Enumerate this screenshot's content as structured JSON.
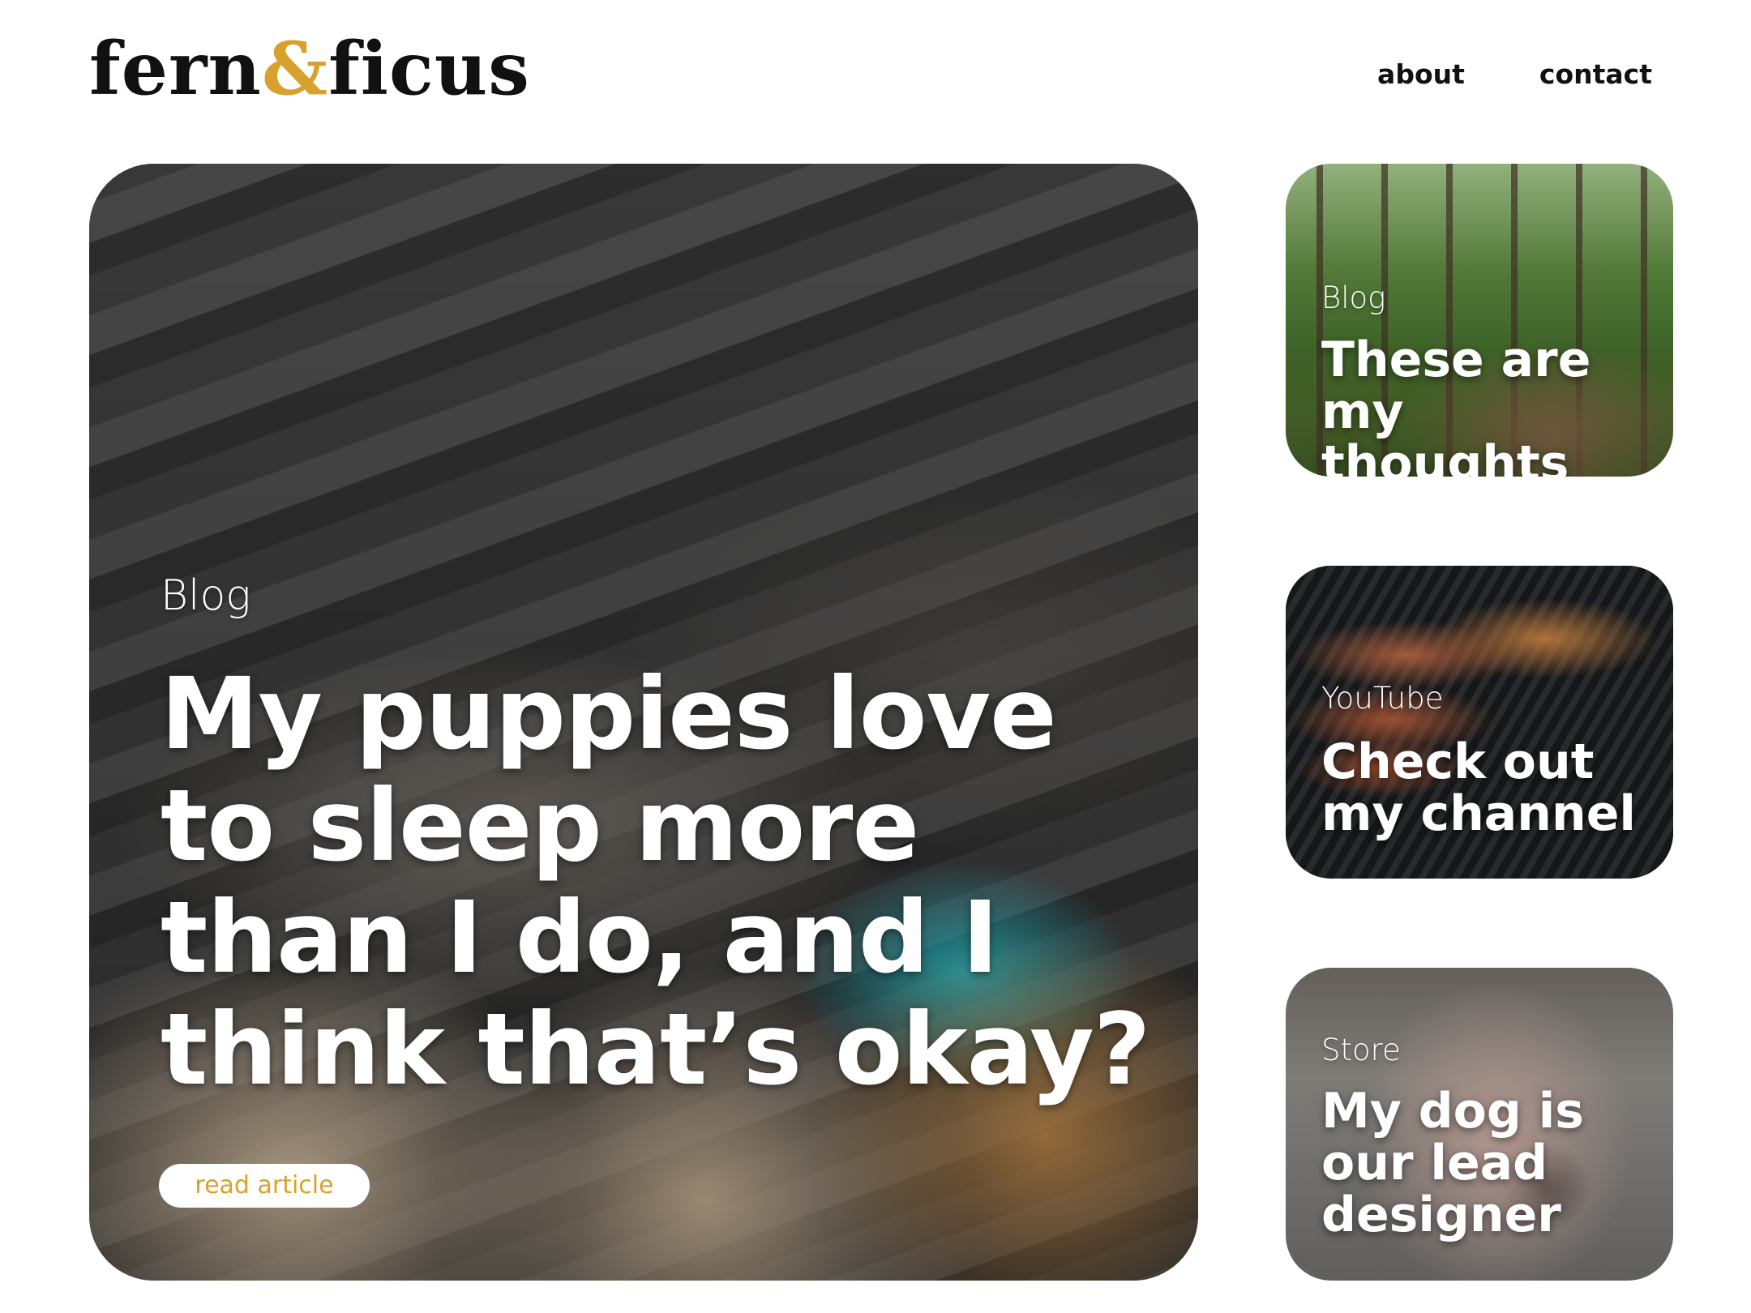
{
  "brand": {
    "part1": "fern",
    "amp": "&",
    "part2": "ficus"
  },
  "nav": {
    "about": "about",
    "contact": "contact"
  },
  "colors": {
    "accent": "#d8a12d",
    "text": "#111111",
    "background": "#ffffff"
  },
  "hero": {
    "kicker": "Blog",
    "title": "My puppies love to sleep more than I do, and I think that’s okay?",
    "cta": "read article"
  },
  "side_cards": [
    {
      "kicker": "Blog",
      "title": "These are my thoughts"
    },
    {
      "kicker": "YouTube",
      "title": "Check out my channel"
    },
    {
      "kicker": "Store",
      "title": "My dog is our lead designer"
    }
  ]
}
